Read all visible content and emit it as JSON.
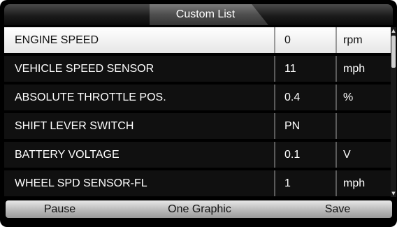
{
  "title": "Custom List",
  "rows": [
    {
      "name": "ENGINE SPEED",
      "value": "0",
      "unit": "rpm",
      "selected": true
    },
    {
      "name": "VEHICLE SPEED SENSOR",
      "value": "11",
      "unit": "mph",
      "selected": false
    },
    {
      "name": "ABSOLUTE THROTTLE POS.",
      "value": "0.4",
      "unit": "%",
      "selected": false
    },
    {
      "name": "SHIFT LEVER SWITCH",
      "value": "PN",
      "unit": "",
      "selected": false
    },
    {
      "name": "BATTERY VOLTAGE",
      "value": "0.1",
      "unit": "V",
      "selected": false
    },
    {
      "name": "WHEEL SPD SENSOR-FL",
      "value": "1",
      "unit": "mph",
      "selected": false
    }
  ],
  "scroll": {
    "up_glyph": "▲",
    "down_glyph": "▼"
  },
  "buttons": {
    "pause": "Pause",
    "one_graphic": "One Graphic",
    "save": "Save"
  }
}
